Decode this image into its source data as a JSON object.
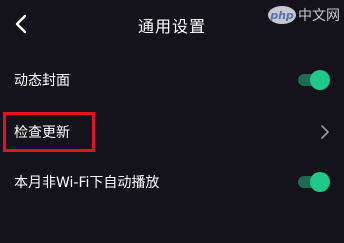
{
  "header": {
    "title": "通用设置",
    "back_icon": "chevron-left-icon"
  },
  "watermark": {
    "logo": "php",
    "text": "中文网"
  },
  "settings": {
    "dynamic_cover": {
      "label": "动态封面",
      "enabled": true
    },
    "check_update": {
      "label": "检查更新",
      "icon": "chevron-right-icon"
    },
    "autoplay_wifi": {
      "label": "本月非Wi-Fi下自动播放",
      "enabled": true
    }
  },
  "colors": {
    "background": "#14131c",
    "toggle_on": "#20c88a",
    "highlight_box": "#e0161e"
  }
}
